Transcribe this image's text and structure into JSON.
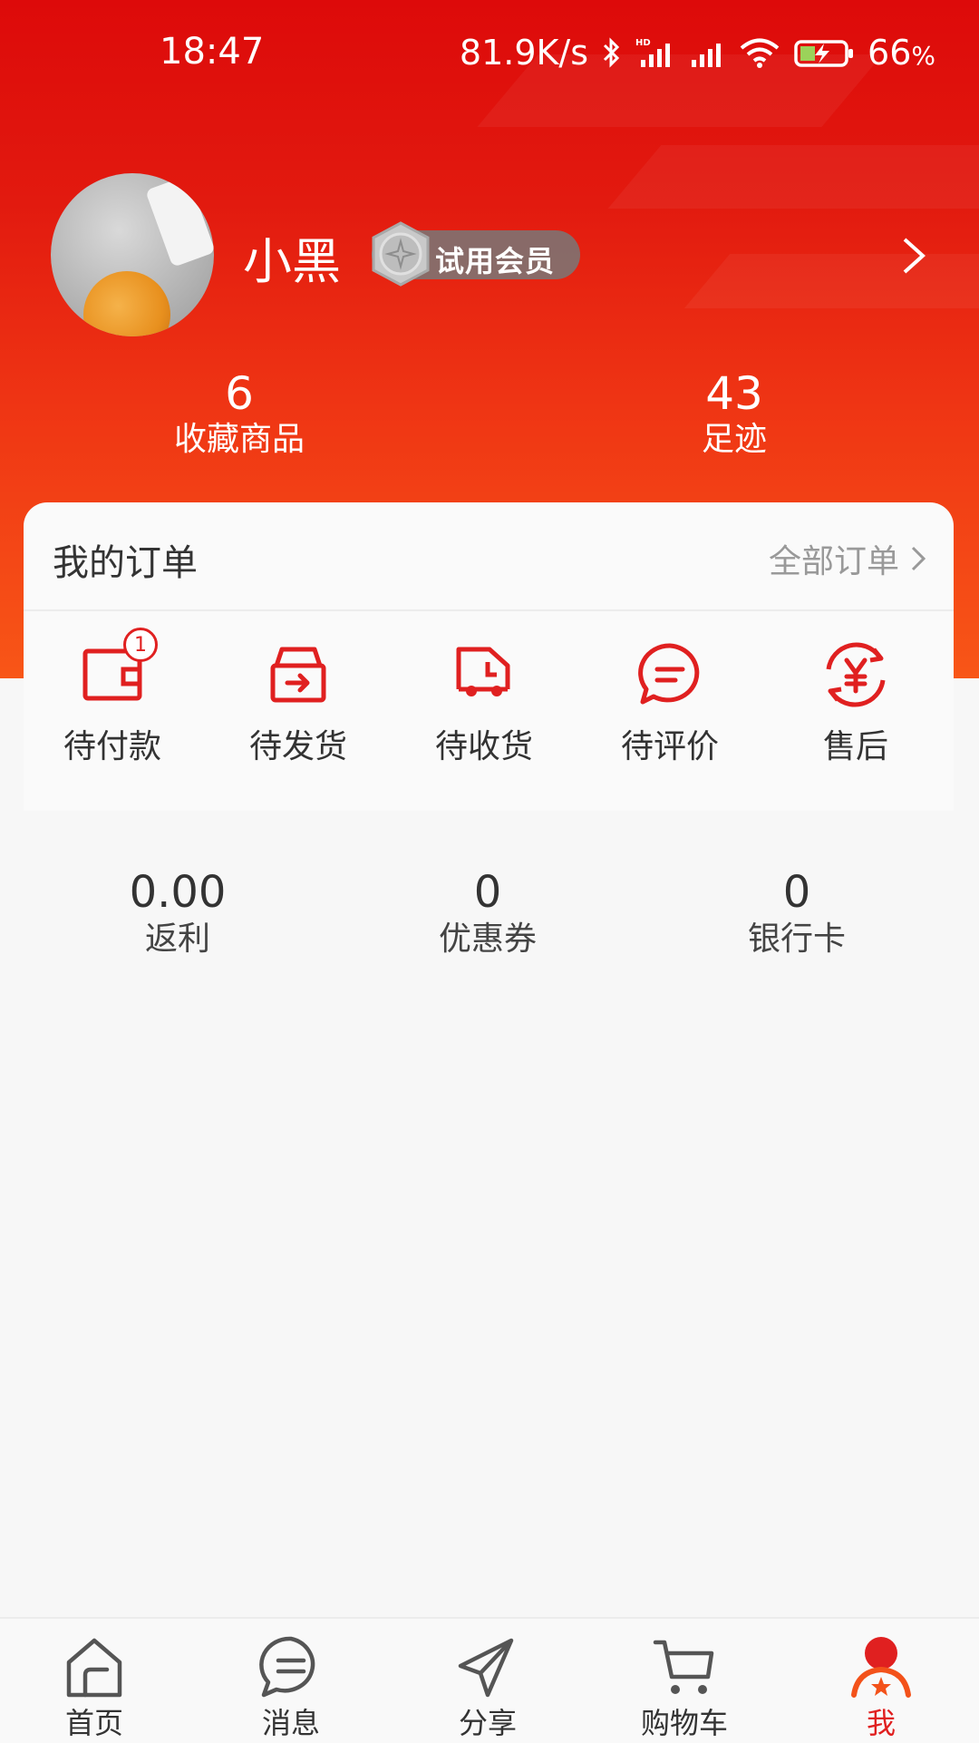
{
  "status_bar": {
    "time": "18:47",
    "net_speed": "81.9K/s",
    "battery_value": "66",
    "battery_unit": "%"
  },
  "profile": {
    "name": "小黑",
    "member_label": "试用会员"
  },
  "stats": [
    {
      "value": "6",
      "label": "收藏商品"
    },
    {
      "value": "43",
      "label": "足迹"
    }
  ],
  "orders": {
    "title": "我的订单",
    "all_label": "全部订单",
    "items": [
      {
        "label": "待付款",
        "icon": "wallet-icon",
        "badge": "1"
      },
      {
        "label": "待发货",
        "icon": "box-arrow-icon"
      },
      {
        "label": "待收货",
        "icon": "truck-icon"
      },
      {
        "label": "待评价",
        "icon": "chat-bubble-icon"
      },
      {
        "label": "售后",
        "icon": "yen-refresh-icon"
      }
    ]
  },
  "assets": [
    {
      "value": "0.00",
      "label": "返利"
    },
    {
      "value": "0",
      "label": "优惠券"
    },
    {
      "value": "0",
      "label": "银行卡"
    }
  ],
  "nav": [
    {
      "label": "首页",
      "icon": "home-icon"
    },
    {
      "label": "消息",
      "icon": "message-icon"
    },
    {
      "label": "分享",
      "icon": "send-icon"
    },
    {
      "label": "购物车",
      "icon": "cart-icon"
    },
    {
      "label": "我",
      "icon": "user-icon",
      "active": true
    }
  ],
  "colors": {
    "accent": "#e02020",
    "header_top": "#dd0a0a",
    "header_bottom": "#f85617"
  }
}
